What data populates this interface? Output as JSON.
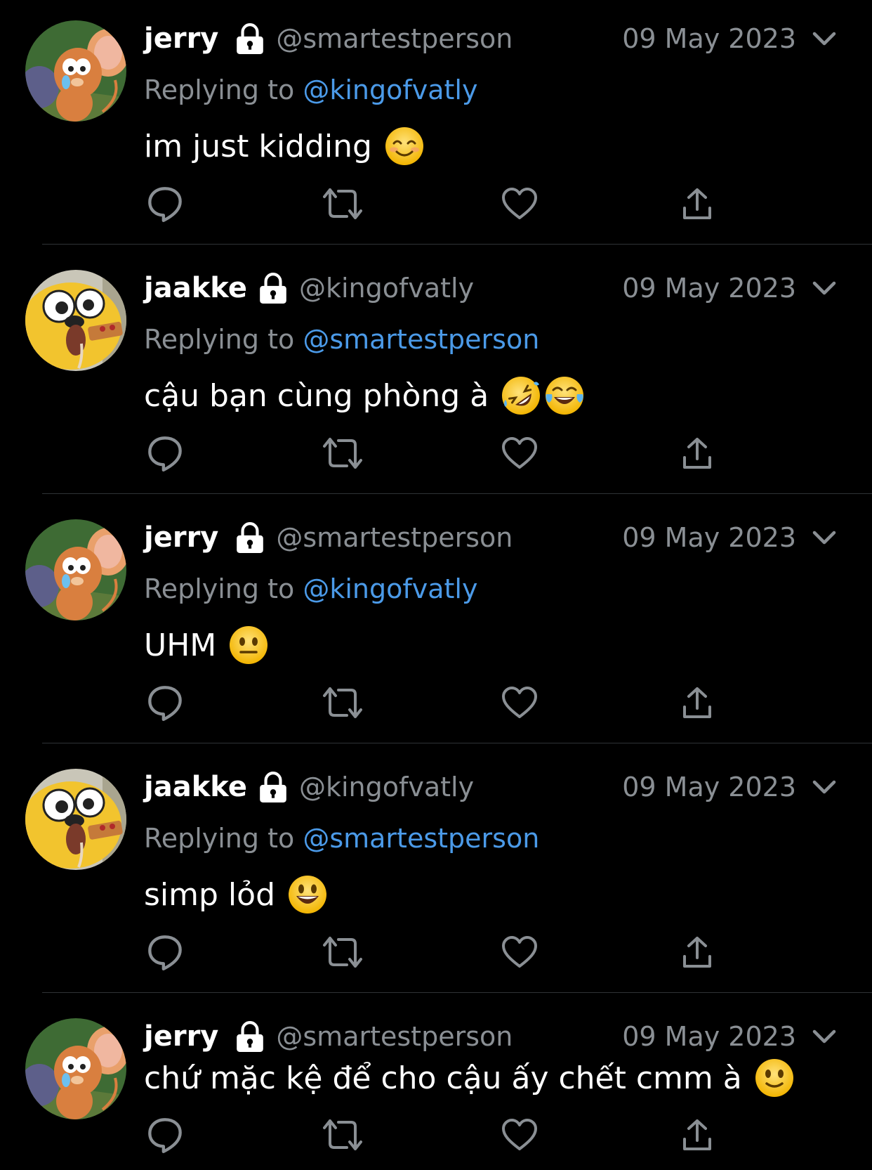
{
  "colors": {
    "background": "#000000",
    "secondary": "#8a8f94",
    "mention": "#4b9ae8",
    "divider": "#2f3336"
  },
  "tweets": [
    {
      "name": "jerry",
      "handle": "@smartestperson",
      "date": "09 May 2023",
      "replying_label": "Replying to",
      "reply_to": "@kingofvatly",
      "text": "im just kidding",
      "emoji": [
        "smiling-face-icon"
      ],
      "avatar": "jerry-mouse-avatar"
    },
    {
      "name": "jaakke",
      "handle": "@kingofvatly",
      "date": "09 May 2023",
      "replying_label": "Replying to",
      "reply_to": "@smartestperson",
      "text": "cậu bạn cùng phòng à",
      "emoji": [
        "rolling-laughing-icon",
        "tears-of-joy-icon"
      ],
      "avatar": "jake-dog-avatar"
    },
    {
      "name": "jerry",
      "handle": "@smartestperson",
      "date": "09 May 2023",
      "replying_label": "Replying to",
      "reply_to": "@kingofvatly",
      "text": "UHM",
      "emoji": [
        "neutral-face-icon"
      ],
      "avatar": "jerry-mouse-avatar"
    },
    {
      "name": "jaakke",
      "handle": "@kingofvatly",
      "date": "09 May 2023",
      "replying_label": "Replying to",
      "reply_to": "@smartestperson",
      "text": "simp lỏd",
      "emoji": [
        "grinning-face-icon"
      ],
      "avatar": "jake-dog-avatar"
    },
    {
      "name": "jerry",
      "handle": "@smartestperson",
      "date": "09 May 2023",
      "text": "chứ mặc kệ để cho cậu ấy chết cmm à",
      "emoji": [
        "slightly-smiling-icon"
      ],
      "avatar": "jerry-mouse-avatar"
    }
  ],
  "action_icons": [
    "reply-icon",
    "retweet-icon",
    "like-icon",
    "share-icon"
  ]
}
